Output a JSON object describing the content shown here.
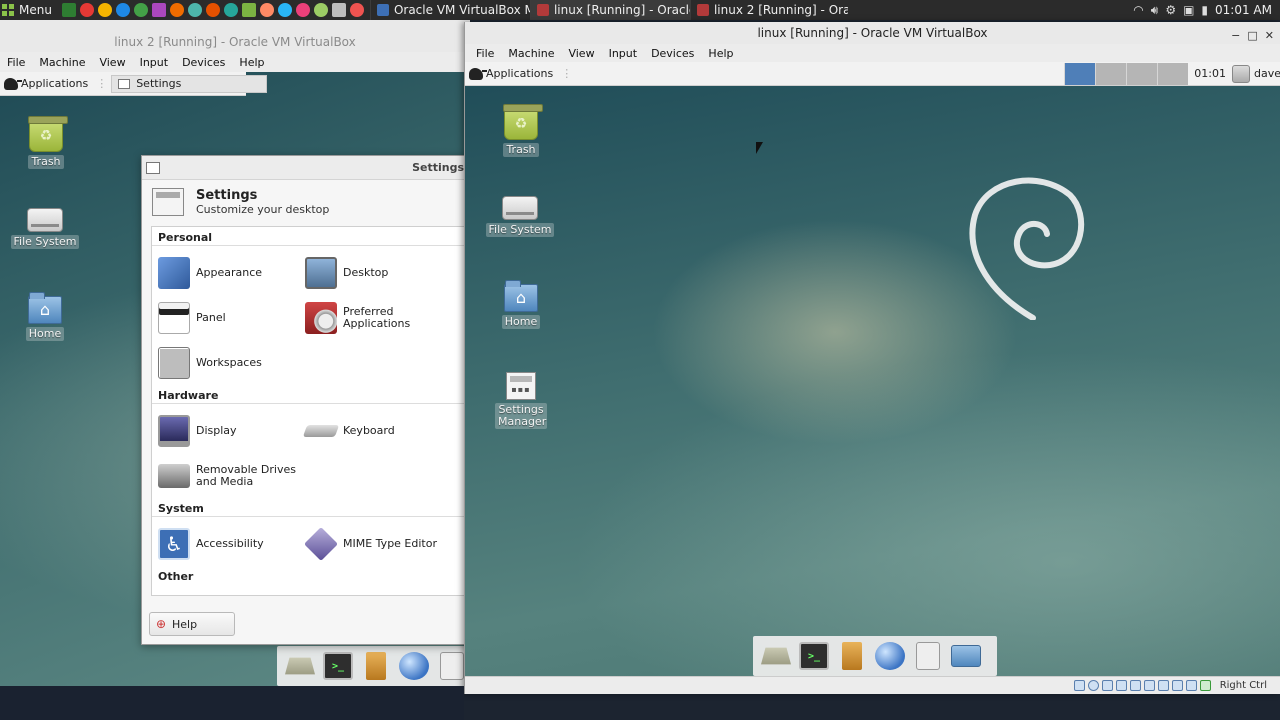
{
  "host_panel": {
    "menu_label": "Menu",
    "launcher_colors": [
      "#2e7d32",
      "#e53935",
      "#f4b400",
      "#1e88e5",
      "#43a047",
      "#ab47bc",
      "#ef6c00",
      "#4db6ac",
      "#e65100",
      "#26a69a",
      "#7cb342",
      "#ff8a65",
      "#29b6f6",
      "#ec407a",
      "#9ccc65",
      "#bdbdbd",
      "#ef5350"
    ],
    "tasks": [
      {
        "label": "Oracle VM VirtualBox M...",
        "icon_color": "#3d6fb5",
        "active": false
      },
      {
        "label": "linux [Running] - Oracle...",
        "icon_color": "#b23a3a",
        "active": true
      },
      {
        "label": "linux 2 [Running] - Orac...",
        "icon_color": "#b23a3a",
        "active": false
      }
    ],
    "tray_icons": [
      "wifi-icon",
      "volume-icon",
      "gear-icon",
      "camera-icon",
      "battery-icon"
    ],
    "clock": "01:01 AM"
  },
  "vm2": {
    "title": "linux 2 [Running] - Oracle VM VirtualBox",
    "menu": [
      "File",
      "Machine",
      "View",
      "Input",
      "Devices",
      "Help"
    ],
    "guest": {
      "apps_label": "Applications",
      "window_button_label": "Settings",
      "desktop_icons": [
        {
          "label": "Trash"
        },
        {
          "label": "File System"
        },
        {
          "label": "Home"
        }
      ]
    },
    "settings": {
      "window_title": "Settings",
      "header_title": "Settings",
      "header_subtitle": "Customize your desktop",
      "sections": {
        "personal": {
          "title": "Personal",
          "items": [
            {
              "label": "Appearance",
              "color": "#4a78b8"
            },
            {
              "label": "Desktop",
              "color": "#6f8fb0"
            },
            {
              "label": "Panel",
              "color": "#222222"
            },
            {
              "label": "Preferred Applications",
              "color": "#b83a3a"
            },
            {
              "label": "Workspaces",
              "color": "#8c8c8c"
            }
          ]
        },
        "hardware": {
          "title": "Hardware",
          "items": [
            {
              "label": "Display",
              "color": "#4a4a8a"
            },
            {
              "label": "Keyboard",
              "color": "#9a9a9a"
            },
            {
              "label": "Removable Drives and Media",
              "color": "#777777"
            }
          ]
        },
        "system": {
          "title": "System",
          "items": [
            {
              "label": "Accessibility",
              "color": "#3d6fb5"
            },
            {
              "label": "MIME Type Editor",
              "color": "#7a6fa8"
            }
          ]
        },
        "other": {
          "title": "Other"
        }
      },
      "help_label": "Help"
    }
  },
  "vm1": {
    "title": "linux [Running] - Oracle VM VirtualBox",
    "menu": [
      "File",
      "Machine",
      "View",
      "Input",
      "Devices",
      "Help"
    ],
    "guest": {
      "apps_label": "Applications",
      "workspaces": 4,
      "active_workspace": 1,
      "clock": "01:01",
      "user": "dave",
      "desktop_icons": [
        {
          "label": "Trash"
        },
        {
          "label": "File System"
        },
        {
          "label": "Home"
        },
        {
          "label": "Settings Manager"
        }
      ]
    },
    "status_bar": {
      "host_key": "Right Ctrl",
      "icons": [
        "hard-disk-icon",
        "optical-drive-icon",
        "audio-icon",
        "network-icon",
        "usb-icon",
        "shared-folder-icon",
        "display-icon",
        "video-capture-icon",
        "cpu-icon",
        "mouse-integration-icon"
      ]
    }
  },
  "dock_items": [
    "drive-icon",
    "terminal-icon",
    "file-manager-icon",
    "web-browser-icon",
    "app-finder-icon",
    "folder-icon"
  ]
}
